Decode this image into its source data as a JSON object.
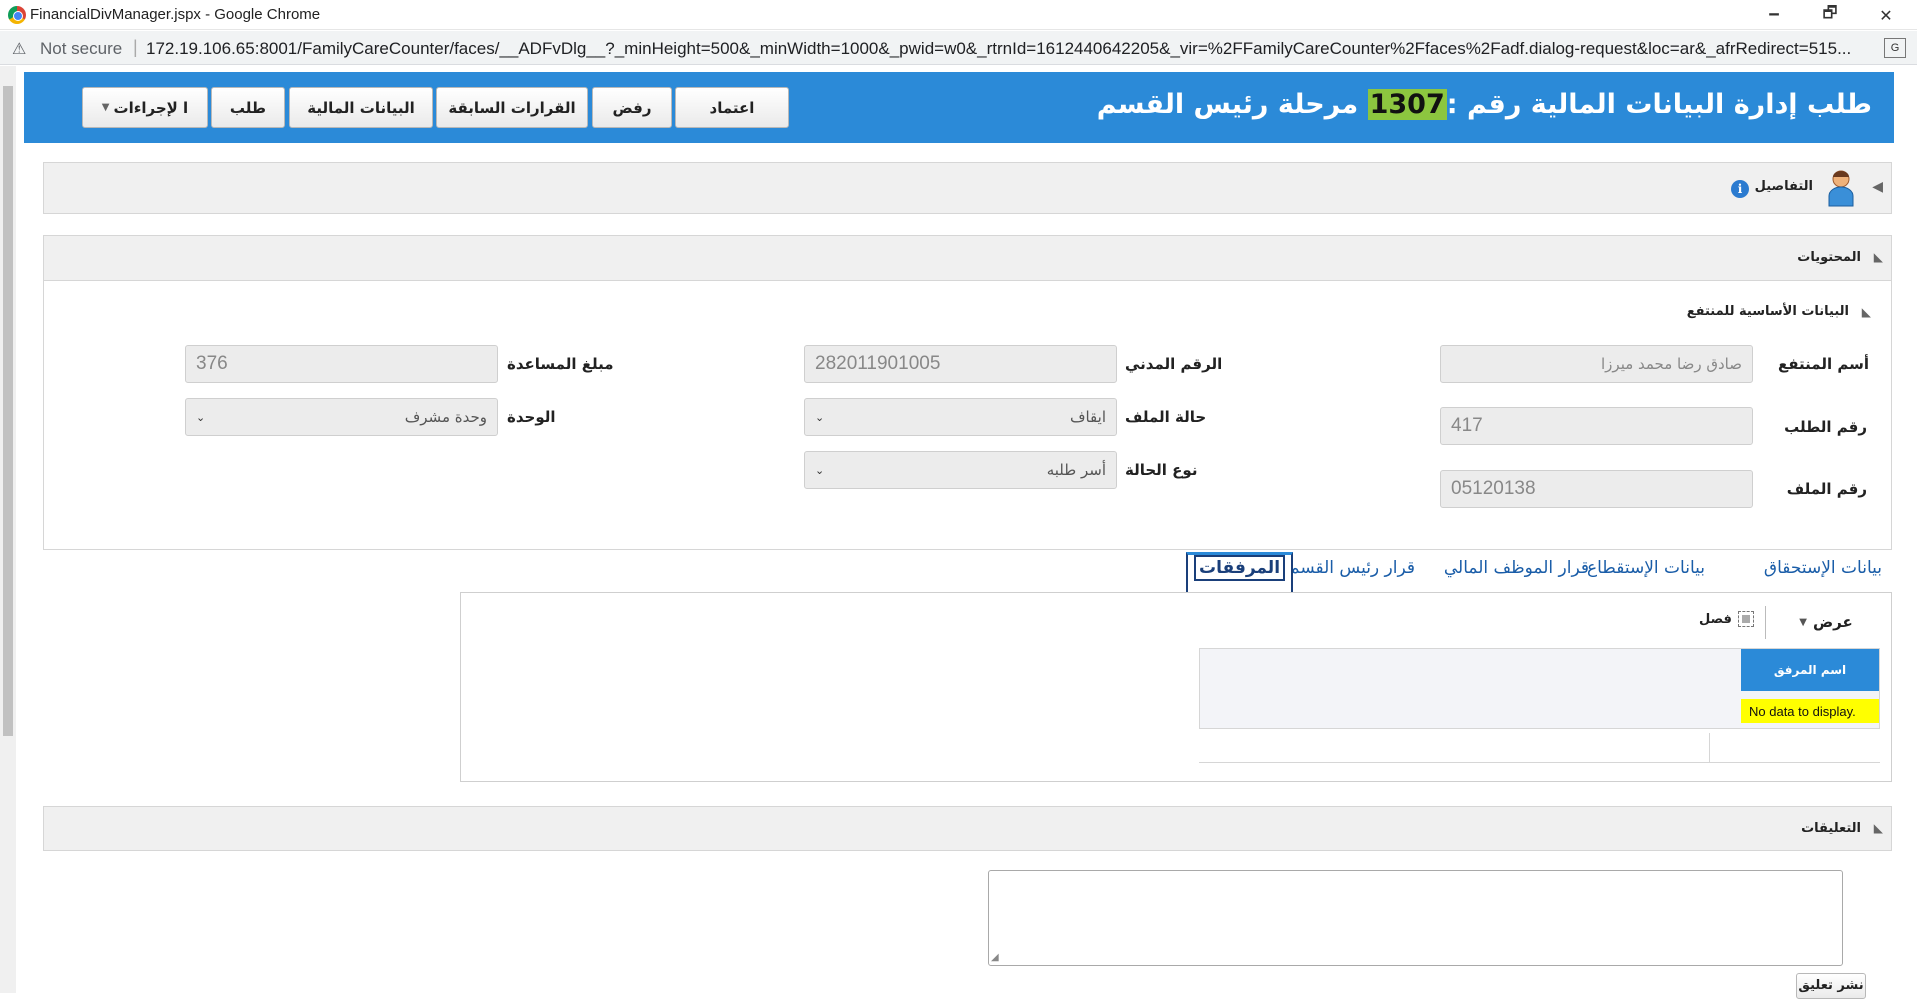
{
  "window": {
    "title": "FinancialDivManager.jspx - Google Chrome",
    "minimize": "🗕",
    "maximize": "🗗",
    "close": "✕"
  },
  "address": {
    "security": "Not secure",
    "url": "172.19.106.65:8001/FamilyCareCounter/faces/__ADFvDlg__?_minHeight=500&_minWidth=1000&_pwid=w0&_rtrnId=1612440642205&_vir=%2FFamilyCareCounter%2Ffaces%2Fadf.dialog-request&loc=ar&_afrRedirect=515..."
  },
  "header": {
    "title_prefix": "طلب إدارة البيانات المالية رقم :",
    "request_number": "1307",
    "title_suffix": " مرحلة رئيس القسم",
    "buttons": {
      "approve": "اعتماد",
      "reject": "رفض",
      "previous_decisions": "القرارات السابقة",
      "financial_data": "البيانات المالية",
      "request": "طلب",
      "actions": "ا لإجراءات"
    }
  },
  "details": {
    "label": "التفاصيل"
  },
  "contents": {
    "label": "المحتويات",
    "section_label": "البيانات الأساسية للمنتفع",
    "fields": {
      "beneficiary_name_label": "أسم المنتفع",
      "beneficiary_name": "صادق رضا محمد ميرزا",
      "request_number_label": "رقم الطلب",
      "request_number": "417",
      "file_number_label": "رقم الملف",
      "file_number": "05120138",
      "civil_id_label": "الرقم المدني",
      "civil_id": "282011901005",
      "file_status_label": "حالة الملف",
      "file_status": "ايقاف",
      "case_type_label": "نوع الحالة",
      "case_type": "أسر طلبه",
      "aid_amount_label": "مبلغ المساعدة",
      "aid_amount": "376",
      "unit_label": "الوحدة",
      "unit": "وحدة مشرف"
    }
  },
  "tabs": {
    "eligibility": "بيانات الإستحقاق",
    "deduction": "بيانات الإستقطاع",
    "financial_officer": "قرار الموظف المالي",
    "head_decision": "قرار رئيس القسم",
    "attachments": "المرفقات"
  },
  "attachments": {
    "view_menu": "عرض",
    "detach": "فصل",
    "column_name": "اسم المرفق",
    "empty": "No data to display."
  },
  "comments": {
    "label": "التعليقات",
    "placeholder": "",
    "publish_button": "نشر تعليق"
  }
}
